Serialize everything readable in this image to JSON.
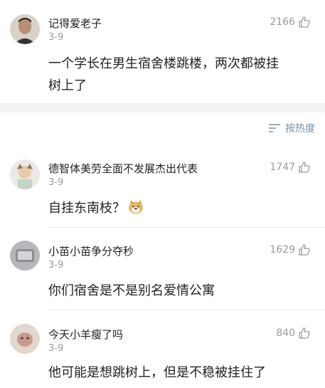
{
  "post": {
    "username": "记得爱老子",
    "date": "3-9",
    "likes": "2166",
    "text_line1": "一个学长在男生宿舍楼跳楼，两次都被挂",
    "text_line2": "树上了"
  },
  "sort": {
    "label": "按热度"
  },
  "comments": [
    {
      "username": "德智体美劳全面不发展杰出代表",
      "date": "3-9",
      "likes": "1747",
      "text": "自挂东南枝？"
    },
    {
      "username": "小苗小苗争分夺秒",
      "date": "3-9",
      "likes": "1629",
      "text": "你们宿舍是不是别名爱情公寓"
    },
    {
      "username": "今天小羊瘦了吗",
      "date": "3-9",
      "likes": "840",
      "text": "他可能是想跳树上，但是不稳被挂住了"
    }
  ],
  "colors": {
    "accent": "#7b8fa8",
    "muted": "#999999",
    "separator": "#f2f2f2"
  }
}
